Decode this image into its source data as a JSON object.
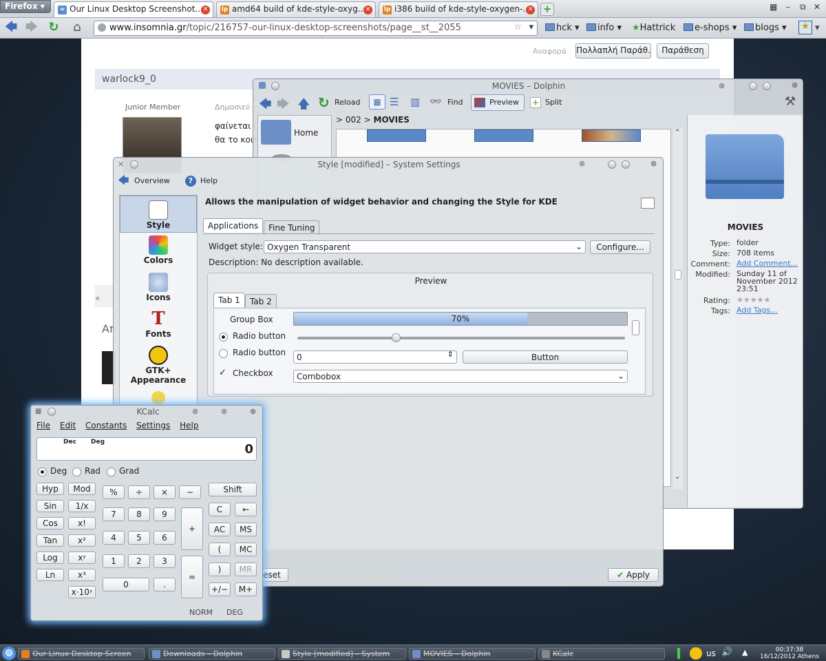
{
  "firefox": {
    "menu_label": "Firefox",
    "tabs": [
      {
        "label": "Our Linux Desktop Screenshot..."
      },
      {
        "label": "amd64 build of kde-style-oxyg..."
      },
      {
        "label": "i386 build of kde-style-oxygen-..."
      }
    ],
    "url_domain": "www.insomnia.gr",
    "url_path": "/topic/216757-our-linux-desktop-screenshots/page__st__2055",
    "bookmarks": [
      "hck",
      "info",
      "Hattrick",
      "e-shops",
      "blogs"
    ]
  },
  "webpage": {
    "reference_label": "Αναφορά",
    "multi_quote": "Πολλαπλή Παράθ.",
    "quote": "Παράθεση",
    "username": "warlock9_0",
    "rank": "Junior Member",
    "posted": "Δημοσιεύ",
    "post_line1": "φαίνεται \\",
    "post_line2": "θα το κοιτ",
    "partial_a": "Απ"
  },
  "dolphin": {
    "title": "MOVIES – Dolphin",
    "toolbar": {
      "reload": "Reload",
      "find": "Find",
      "preview": "Preview",
      "split": "Split"
    },
    "breadcrumb_parent": "002",
    "breadcrumb_current": "MOVIES",
    "places_home": "Home",
    "info": {
      "name": "MOVIES",
      "type_k": "Type:",
      "type_v": "folder",
      "size_k": "Size:",
      "size_v": "708 items",
      "comment_k": "Comment:",
      "comment_v": "Add Comment...",
      "modified_k": "Modified:",
      "modified_v": "Sunday 11 of November 2012 23:51",
      "rating_k": "Rating:",
      "rating_v": "★★★★★",
      "tags_k": "Tags:",
      "tags_v": "Add Tags..."
    }
  },
  "settings": {
    "title": "Style [modified] – System Settings",
    "overview": "Overview",
    "help": "Help",
    "side_items": [
      "Style",
      "Colors",
      "Icons",
      "Fonts",
      "GTK+ Appearance"
    ],
    "heading": "Allows the manipulation of widget behavior and changing the Style for KDE",
    "tabs": [
      "Applications",
      "Fine Tuning"
    ],
    "widget_style_label": "Widget style:",
    "widget_style_value": "Oxygen Transparent",
    "configure": "Configure...",
    "description": "Description: No description available.",
    "preview_title": "Preview",
    "preview_tabs": [
      "Tab 1",
      "Tab 2"
    ],
    "group_box": "Group Box",
    "progress_label": "70%",
    "progress_value": 0.7,
    "slider_value": 0.3,
    "radio1": "Radio button",
    "radio2": "Radio button",
    "checkbox": "Checkbox",
    "spin_value": "0",
    "button": "Button",
    "combobox": "Combobox",
    "reset": "eset",
    "apply": "Apply"
  },
  "kcalc": {
    "title": "KCalc",
    "menu": [
      "File",
      "Edit",
      "Constants",
      "Settings",
      "Help"
    ],
    "mode_dec": "Dec",
    "mode_deg": "Deg",
    "display": "0",
    "angle": [
      "Deg",
      "Rad",
      "Grad"
    ],
    "left_buttons": [
      [
        "Hyp",
        "Mod"
      ],
      [
        "Sin",
        "1/x"
      ],
      [
        "Cos",
        "x!"
      ],
      [
        "Tan",
        "x²"
      ],
      [
        "Log",
        "xʸ"
      ],
      [
        "Ln",
        "x³"
      ],
      [
        "",
        "x·10ʸ"
      ]
    ],
    "num_rows": [
      [
        "%",
        "÷",
        "×",
        "−"
      ],
      [
        "7",
        "8",
        "9"
      ],
      [
        "4",
        "5",
        "6"
      ],
      [
        "1",
        "2",
        "3"
      ],
      [
        "0",
        "."
      ]
    ],
    "plus": "+",
    "equals": "=",
    "right_buttons": [
      "Shift",
      "C",
      "←",
      "AC",
      "MS",
      "(",
      "MC",
      ")",
      "MR",
      "+/−",
      "M+"
    ],
    "status_norm": "NORM",
    "status_deg": "DEG"
  },
  "taskbar": {
    "tasks": [
      "Our Linux Desktop Screen",
      "Downloads – Dolphin",
      "Style [modified] – System",
      "MOVIES – Dolphin",
      "KCalc"
    ],
    "kbd": "us",
    "time": "00:37:38",
    "date": "16/12/2012 Athens"
  }
}
